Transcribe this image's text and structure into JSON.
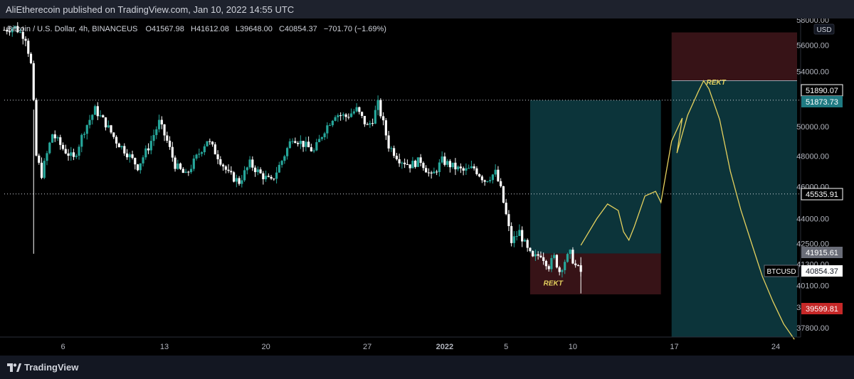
{
  "header": {
    "published": "AliEtherecoin published on TradingView.com, Jan 10, 2022 14:55 UTC"
  },
  "symbol_info": {
    "name": "Bitcoin / U.S. Dollar, 4h, BINANCEUS",
    "open_label": "O",
    "open": "41567.98",
    "high_label": "H",
    "high": "41612.08",
    "low_label": "L",
    "low": "39648.00",
    "close_label": "C",
    "close": "40854.37",
    "change": "−701.70 (−1.69%)"
  },
  "footer": {
    "brand": "TradingView"
  },
  "colors": {
    "background": "#131722",
    "up": "#26a69a",
    "down": "#ffffff",
    "projection": "#e5d15e",
    "target_zone": "#0d3a40",
    "stop_zone": "#3a1418",
    "price_red": "#c62828",
    "price_teal": "#1f7a82"
  },
  "chart_data": {
    "type": "candlestick",
    "title": "Bitcoin / U.S. Dollar, 4h, BINANCEUS",
    "currency": "USD",
    "scale": "log",
    "ylim": [
      37200,
      58000
    ],
    "grid": false,
    "y_ticks": [
      58000,
      56000,
      54000,
      50000,
      48000,
      46000,
      44000,
      42500,
      41300,
      40100,
      38900,
      37800
    ],
    "x_ticks": [
      "6",
      "13",
      "20",
      "27",
      "2022",
      "5",
      "10",
      "17",
      "24"
    ],
    "close_path": [
      [
        0,
        57200
      ],
      [
        4,
        57400
      ],
      [
        8,
        56600
      ],
      [
        10,
        54500
      ],
      [
        11,
        51600
      ],
      [
        12,
        48000
      ],
      [
        14,
        46800
      ],
      [
        18,
        49500
      ],
      [
        22,
        48500
      ],
      [
        26,
        47800
      ],
      [
        30,
        49800
      ],
      [
        34,
        51200
      ],
      [
        38,
        50200
      ],
      [
        42,
        49000
      ],
      [
        46,
        48200
      ],
      [
        50,
        47300
      ],
      [
        54,
        48600
      ],
      [
        58,
        50300
      ],
      [
        61,
        49000
      ],
      [
        64,
        47400
      ],
      [
        68,
        46700
      ],
      [
        72,
        47900
      ],
      [
        76,
        49100
      ],
      [
        80,
        48000
      ],
      [
        84,
        46800
      ],
      [
        88,
        46300
      ],
      [
        92,
        47500
      ],
      [
        96,
        46800
      ],
      [
        100,
        46300
      ],
      [
        104,
        47700
      ],
      [
        108,
        49300
      ],
      [
        112,
        48800
      ],
      [
        116,
        48300
      ],
      [
        120,
        49800
      ],
      [
        124,
        50900
      ],
      [
        128,
        50700
      ],
      [
        132,
        51200
      ],
      [
        136,
        50000
      ],
      [
        138,
        50500
      ],
      [
        140,
        51600
      ],
      [
        142,
        50200
      ],
      [
        144,
        48700
      ],
      [
        148,
        47800
      ],
      [
        152,
        47400
      ],
      [
        156,
        47700
      ],
      [
        160,
        46600
      ],
      [
        164,
        47700
      ],
      [
        168,
        47300
      ],
      [
        172,
        47000
      ],
      [
        176,
        47200
      ],
      [
        180,
        46400
      ],
      [
        184,
        46900
      ],
      [
        186,
        45800
      ],
      [
        188,
        44200
      ],
      [
        190,
        42600
      ],
      [
        193,
        43200
      ],
      [
        196,
        42100
      ],
      [
        198,
        41600
      ],
      [
        201,
        41900
      ],
      [
        204,
        41200
      ],
      [
        206,
        41700
      ],
      [
        208,
        40900
      ],
      [
        210,
        41500
      ],
      [
        212,
        41900
      ],
      [
        214,
        41200
      ],
      [
        216,
        40854
      ]
    ],
    "horizontal_lines": [
      {
        "price": 51873.73,
        "label": "51873.73",
        "style": "dotted"
      },
      {
        "price": 45535.91,
        "label": "45535.91",
        "style": "dotted"
      }
    ],
    "price_labels": [
      {
        "value": "51890.07",
        "kind": "line"
      },
      {
        "value": "51873.73",
        "kind": "teal"
      },
      {
        "value": "45535.91",
        "kind": "line"
      },
      {
        "value": "41915.61",
        "kind": "gray"
      },
      {
        "value": "40854.37",
        "kind": "current"
      },
      {
        "value": "39599.81",
        "kind": "red"
      }
    ],
    "symbol_tag": "BTCUSD",
    "position_1": {
      "entry": 41915.61,
      "target": 51873.73,
      "stop": 39599.81,
      "annotation": "REKT"
    },
    "position_2": {
      "entry": 53300,
      "stop": 57000,
      "annotation": "REKT"
    },
    "projection_path": [
      [
        216,
        42400
      ],
      [
        222,
        44000
      ],
      [
        226,
        44900
      ],
      [
        230,
        44500
      ],
      [
        232,
        43200
      ],
      [
        234,
        42700
      ],
      [
        236,
        43500
      ],
      [
        240,
        45400
      ],
      [
        244,
        45700
      ],
      [
        246,
        45000
      ],
      [
        250,
        49000
      ],
      [
        254,
        50600
      ],
      [
        252,
        48200
      ],
      [
        256,
        50800
      ],
      [
        260,
        52500
      ],
      [
        262,
        53300
      ],
      [
        264,
        52700
      ],
      [
        268,
        50500
      ],
      [
        272,
        47000
      ],
      [
        276,
        44500
      ],
      [
        280,
        42500
      ],
      [
        284,
        40600
      ],
      [
        288,
        39200
      ],
      [
        292,
        38000
      ],
      [
        296,
        37200
      ]
    ]
  }
}
